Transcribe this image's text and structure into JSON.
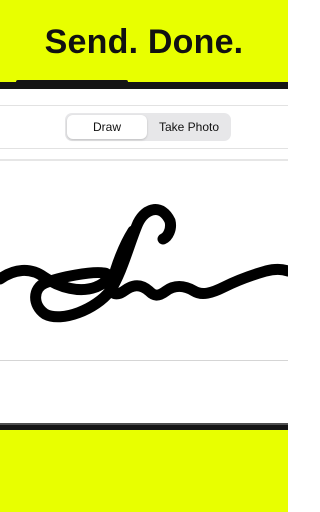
{
  "hero": {
    "title": "Send. Done.",
    "background_color": "#e8ff00",
    "bar_color": "#151515"
  },
  "mode_switch": {
    "options": [
      {
        "label": "Draw",
        "selected": true
      },
      {
        "label": "Take Photo",
        "selected": false
      }
    ]
  },
  "signature_pad": {
    "has_signature": true,
    "ink_color": "#000000"
  },
  "footer": {
    "background_color": "#e8ff00"
  }
}
